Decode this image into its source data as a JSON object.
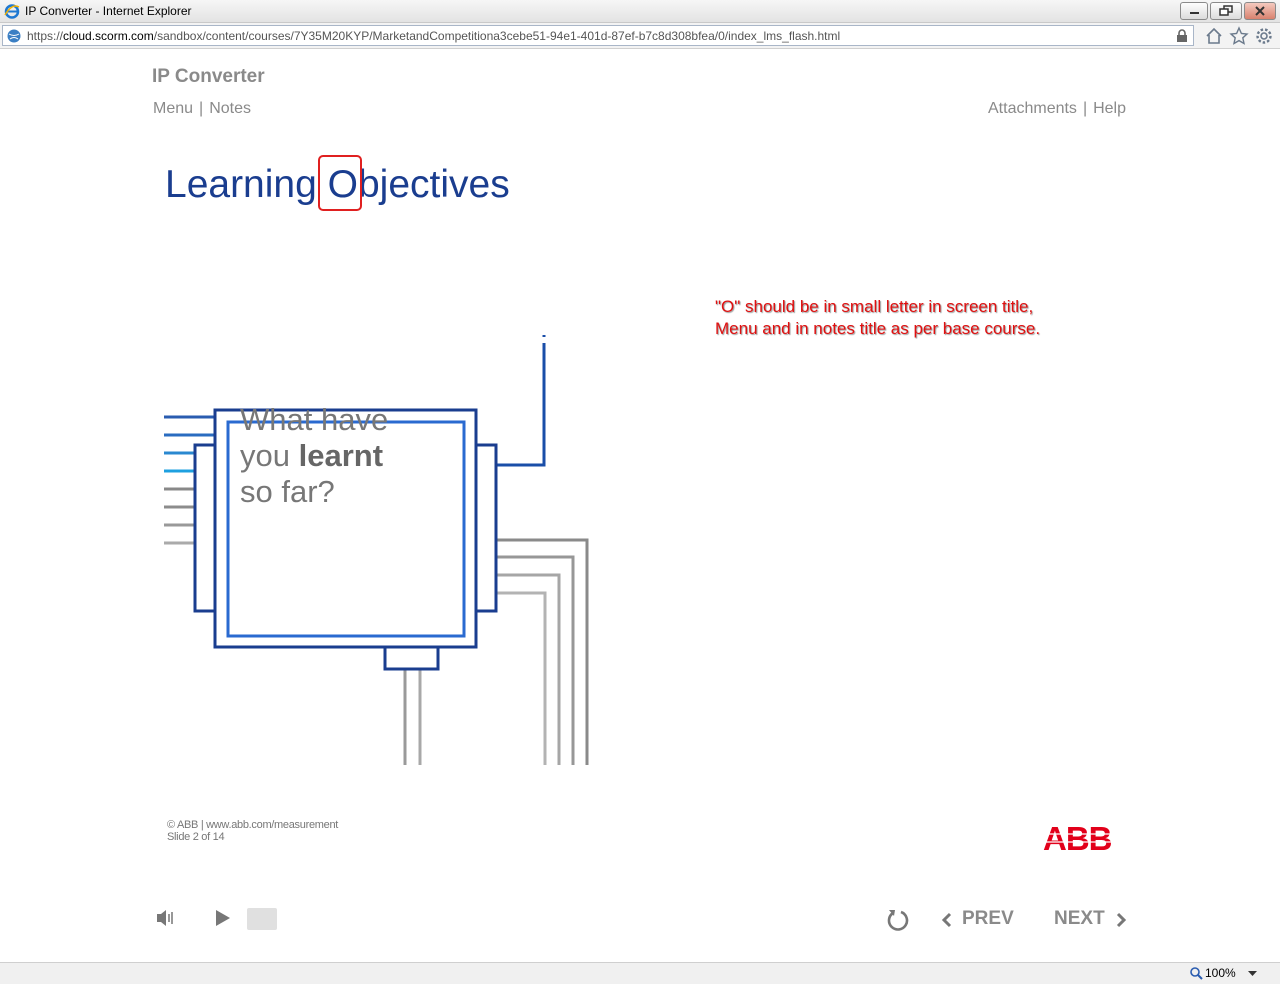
{
  "window": {
    "title": "IP Converter - Internet Explorer"
  },
  "address": {
    "url_prefix": "https://",
    "url_host": "cloud.scorm.com",
    "url_path": "/sandbox/content/courses/7Y35M20KYP/MarketandCompetitiona3cebe51-94e1-401d-87ef-b7c8d308bfea/0/index_lms_flash.html"
  },
  "course": {
    "title": "IP Converter",
    "nav_left": [
      "Menu",
      "Notes"
    ],
    "nav_right": [
      "Attachments",
      "Help"
    ],
    "separator": "|"
  },
  "slide": {
    "title": "Learning Objectives",
    "chip_line1": "What have",
    "chip_line2_a": "you ",
    "chip_line2_b": "learnt",
    "chip_line3": "so far?"
  },
  "annotation": {
    "line1": "\"O\" should be in small letter in screen title,",
    "line2": "Menu and in notes title as per base course."
  },
  "footer": {
    "copyright": "© ABB | www.abb.com/measurement",
    "slide_count": "Slide 2 of 14",
    "logo_text": "ABB"
  },
  "controls": {
    "prev_label": "PREV",
    "next_label": "NEXT"
  },
  "status": {
    "zoom": "100%"
  },
  "colors": {
    "title_blue": "#1a3d8f",
    "annotation_red": "#e01010",
    "abb_red": "#e2001a",
    "nav_gray": "#8a8a8a"
  }
}
